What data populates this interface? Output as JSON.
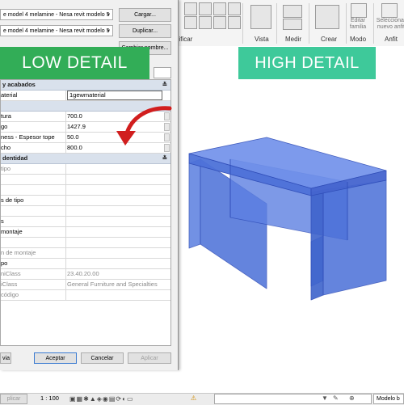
{
  "dialog": {
    "family_combo": "e model 4 melamine - Nesa revit modelo 5",
    "type_combo": "e model 4 melamine - Nesa revit modelo 5",
    "buttons": {
      "load": "Cargar...",
      "duplicate": "Duplicar...",
      "rename": "Cambiar nombre..."
    },
    "footer": {
      "preview": "via",
      "ok": "Aceptar",
      "cancel": "Cancelar",
      "apply": "Aplicar"
    },
    "groups": {
      "materials": "y acabados",
      "dimensions": "",
      "identity": "dentidad"
    },
    "material_row": {
      "label": "aterial",
      "value": "1gewmaterial"
    },
    "dimension_rows": [
      {
        "label": "tura",
        "value": "700.0"
      },
      {
        "label": "go",
        "value": "1427.9"
      },
      {
        "label": "ness - Espesor tope",
        "value": "50.0"
      },
      {
        "label": "cho",
        "value": "800.0"
      }
    ],
    "identity_rows": [
      {
        "label": "tipo",
        "value": ""
      },
      {
        "label": "",
        "value": ""
      },
      {
        "label": "",
        "value": ""
      },
      {
        "label": "s de tipo",
        "value": ""
      },
      {
        "label": "",
        "value": ""
      },
      {
        "label": "s",
        "value": ""
      },
      {
        "label": "montaje",
        "value": ""
      },
      {
        "label": "",
        "value": ""
      },
      {
        "label": "n de montaje",
        "value": ""
      },
      {
        "label": "po",
        "value": ""
      },
      {
        "label": "niClass",
        "value": "23.40.20.00"
      },
      {
        "label": "iClass",
        "value": "General Furniture and Specialties"
      },
      {
        "label": "código",
        "value": ""
      }
    ]
  },
  "ribbon": {
    "labels": {
      "modify": "dificar",
      "view": "Vista",
      "measure": "Medir",
      "create": "Crear",
      "mode": "Modo",
      "family": "Anfit"
    },
    "edit_family": "Editar\nfamilia",
    "select_new": "Seleccionar\nnuevo anfit"
  },
  "banners": {
    "low": "LOW DETAIL",
    "high": "HIGH DETAIL"
  },
  "status": {
    "apply_left": "plicar",
    "scale": "1 : 100",
    "model_right": "Modelo b"
  },
  "colors": {
    "low_banner": "#32ad57",
    "high_banner": "#3ec99a",
    "arrow": "#d11e1e",
    "furniture": "#4a6fd8"
  }
}
